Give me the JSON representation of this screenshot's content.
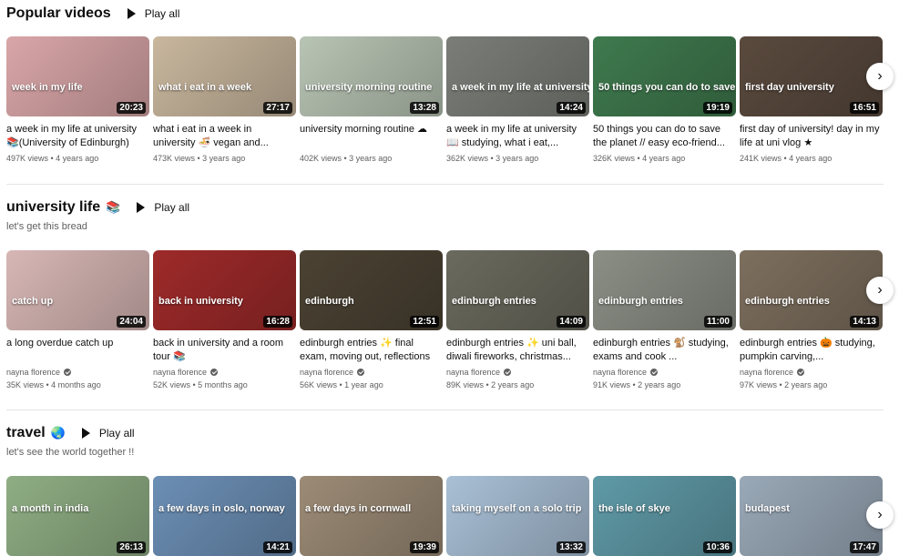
{
  "shelves": [
    {
      "title": "Popular videos",
      "emoji": "",
      "play_all": "Play all",
      "subtitle": "",
      "videos": [
        {
          "thumb_text": "week in my life",
          "duration": "20:23",
          "title": "a week in my life at university 📚(University of Edinburgh)",
          "channel": "",
          "meta": "497K views • 4 years ago",
          "bg": "#d9a6a8"
        },
        {
          "thumb_text": "what i eat in a week",
          "duration": "27:17",
          "title": "what i eat in a week in university 🍜 vegan and...",
          "channel": "",
          "meta": "473K views • 3 years ago",
          "bg": "#c9b79e"
        },
        {
          "thumb_text": "university morning routine",
          "duration": "13:28",
          "title": "university morning routine ☁",
          "channel": "",
          "meta": "402K views • 3 years ago",
          "bg": "#b8c4b4"
        },
        {
          "thumb_text": "a week in my life at university",
          "duration": "14:24",
          "title": "a week in my life at university 📖 studying, what i eat,...",
          "channel": "",
          "meta": "362K views • 3 years ago",
          "bg": "#7b7e78"
        },
        {
          "thumb_text": "50 things you can do to save the planet",
          "duration": "19:19",
          "title": "50 things you can do to save the planet // easy eco-friend...",
          "channel": "",
          "meta": "326K views • 4 years ago",
          "bg": "#3f7a4e"
        },
        {
          "thumb_text": "first day university",
          "duration": "16:51",
          "title": "first day of university! day in my life at uni vlog ★",
          "channel": "",
          "meta": "241K views • 4 years ago",
          "bg": "#5a4a3e"
        }
      ]
    },
    {
      "title": "university life",
      "emoji": "📚",
      "play_all": "Play all",
      "subtitle": "let's get this bread",
      "videos": [
        {
          "thumb_text": "catch up",
          "duration": "24:04",
          "title": "a long overdue catch up",
          "channel": "nayna florence",
          "meta": "35K views • 4 months ago",
          "bg": "#d7b7b5"
        },
        {
          "thumb_text": "back in university",
          "duration": "16:28",
          "title": "back in university and a room tour 📚",
          "channel": "nayna florence",
          "meta": "52K views • 5 months ago",
          "bg": "#9e2a2a"
        },
        {
          "thumb_text": "edinburgh",
          "duration": "12:51",
          "title": "edinburgh entries ✨ final exam, moving out, reflections",
          "channel": "nayna florence",
          "meta": "56K views • 1 year ago",
          "bg": "#4b4233"
        },
        {
          "thumb_text": "edinburgh entries",
          "duration": "14:09",
          "title": "edinburgh entries ✨ uni ball, diwali fireworks, christmas...",
          "channel": "nayna florence",
          "meta": "89K views • 2 years ago",
          "bg": "#6b6a5e"
        },
        {
          "thumb_text": "edinburgh entries",
          "duration": "11:00",
          "title": "edinburgh entries 🐒 studying, exams and cook ...",
          "channel": "nayna florence",
          "meta": "91K views • 2 years ago",
          "bg": "#8c8f86"
        },
        {
          "thumb_text": "edinburgh entries",
          "duration": "14:13",
          "title": "edinburgh entries 🎃 studying, pumpkin carving,...",
          "channel": "nayna florence",
          "meta": "97K views • 2 years ago",
          "bg": "#7d6f5e"
        }
      ]
    },
    {
      "title": "travel",
      "emoji": "🌏",
      "play_all": "Play all",
      "subtitle": "let's see the world together !!",
      "videos": [
        {
          "thumb_text": "a month in india",
          "duration": "26:13",
          "title": "",
          "channel": "",
          "meta": "",
          "bg": "#8fae84"
        },
        {
          "thumb_text": "a few days in oslo, norway",
          "duration": "14:21",
          "title": "",
          "channel": "",
          "meta": "",
          "bg": "#6c8fb5"
        },
        {
          "thumb_text": "a few days in cornwall",
          "duration": "19:39",
          "title": "",
          "channel": "",
          "meta": "",
          "bg": "#9c8b76"
        },
        {
          "thumb_text": "taking myself on a solo trip",
          "duration": "13:32",
          "title": "",
          "channel": "",
          "meta": "",
          "bg": "#a9c0d6"
        },
        {
          "thumb_text": "the isle of skye",
          "duration": "10:36",
          "title": "",
          "channel": "",
          "meta": "",
          "bg": "#5f9aa7"
        },
        {
          "thumb_text": "budapest",
          "duration": "17:47",
          "title": "",
          "channel": "",
          "meta": "",
          "bg": "#9aa9b8"
        }
      ]
    }
  ],
  "next_icon": "›"
}
